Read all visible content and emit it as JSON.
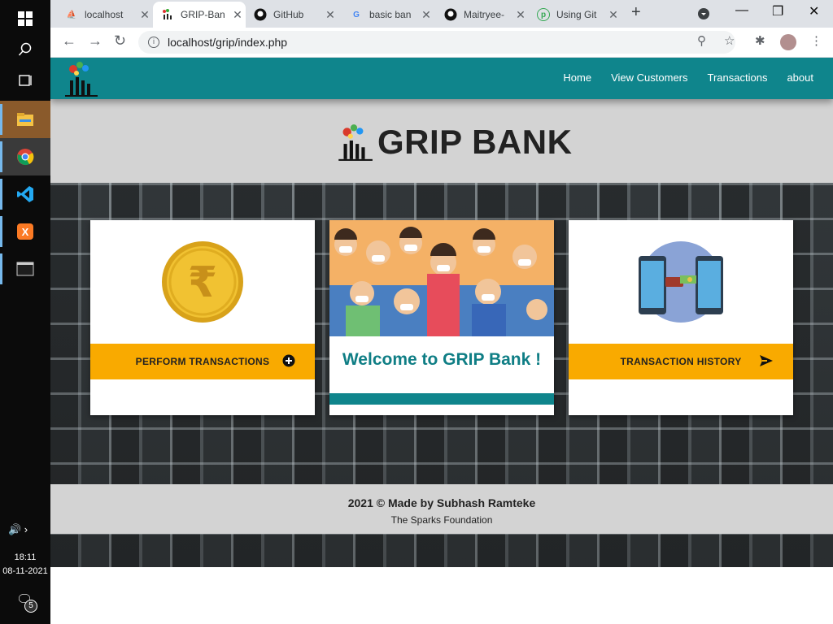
{
  "taskbar": {
    "time": "18:11",
    "date": "08-11-2021",
    "notification_count": "5"
  },
  "tabs": [
    {
      "title": "localhost"
    },
    {
      "title": "GRIP-Ban"
    },
    {
      "title": "GitHub"
    },
    {
      "title": "basic ban"
    },
    {
      "title": "Maitryee-"
    },
    {
      "title": "Using Git"
    }
  ],
  "address_bar": {
    "url": "localhost/grip/index.php"
  },
  "navbar": {
    "links": [
      "Home",
      "View Customers",
      "Transactions",
      "about"
    ]
  },
  "brand": {
    "title": "GRIP BANK"
  },
  "cards": {
    "perform_label": "PERFORM TRANSACTIONS",
    "welcome_text": "Welcome to GRIP Bank !",
    "history_label": "TRANSACTION HISTORY"
  },
  "footer": {
    "line1": "2021 © Made by Subhash Ramteke",
    "line2": "The Sparks Foundation"
  },
  "colors": {
    "navbar": "#0f858c",
    "button": "#f9aa00",
    "welcome_text": "#0f7e85"
  }
}
